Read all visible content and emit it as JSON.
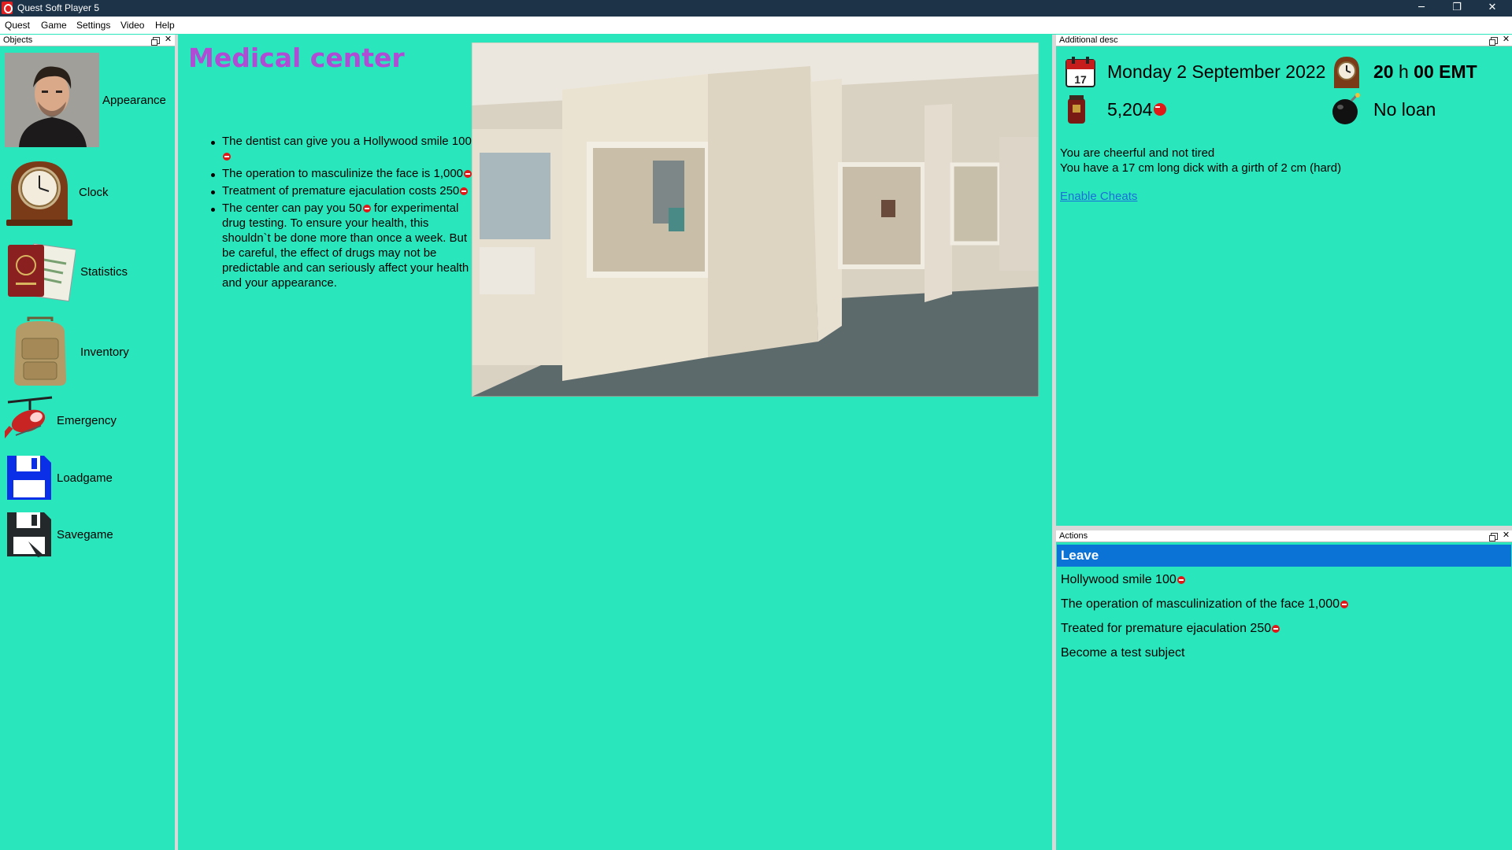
{
  "window": {
    "title": "Quest Soft Player 5",
    "min": "─",
    "restore": "❐",
    "close": "✕"
  },
  "menu": [
    "Quest",
    "Game",
    "Settings",
    "Video",
    "Help"
  ],
  "objects_panel": {
    "title": "Objects",
    "items": [
      {
        "label": "Appearance",
        "icon": "portrait-icon"
      },
      {
        "label": "Clock",
        "icon": "clock-icon"
      },
      {
        "label": "Statistics",
        "icon": "passport-icon"
      },
      {
        "label": "Inventory",
        "icon": "backpack-icon"
      },
      {
        "label": "Emergency",
        "icon": "helicopter-icon"
      },
      {
        "label": "Loadgame",
        "icon": "floppy-blue-icon"
      },
      {
        "label": "Savegame",
        "icon": "floppy-dark-icon"
      }
    ]
  },
  "main": {
    "title": "Medical center",
    "bullets": [
      {
        "text": "The dentist can give you a Hollywood smile 100"
      },
      {
        "text": "The operation to masculinize the face is 1,000"
      },
      {
        "text": "Treatment of premature ejaculation costs 250"
      },
      {
        "pre": "The center can pay you 50",
        "post": " for experimental drug testing. To ensure your health, this shouldn`t be done more than once a week. But be careful, the effect of drugs may not be predictable and can seriously affect your health and your appearance."
      }
    ]
  },
  "desc_panel": {
    "title": "Additional desc",
    "date": "Monday 2 September 2022",
    "calendar_day": "17",
    "time_hours": "20",
    "time_h": "h",
    "time_minutes": "00 EMT",
    "money": "5,204",
    "loan": "No loan",
    "status_lines": [
      "You are cheerful and not tired",
      "You have a 17 cm long dick with a girth of 2 cm  (hard)"
    ],
    "cheat_link": "Enable Cheats"
  },
  "actions_panel": {
    "title": "Actions",
    "items": [
      {
        "label": "Leave",
        "selected": true
      },
      {
        "label": "Hollywood smile 100",
        "coin": true
      },
      {
        "label": "The operation of masculinization of the face 1,000",
        "coin": true
      },
      {
        "label": "Treated for premature ejaculation 250",
        "coin": true
      },
      {
        "label": "Become a test subject",
        "coin": false
      }
    ]
  },
  "colors": {
    "background": "#2ae6bd",
    "title_purple": "#b04bd6",
    "selection_blue": "#0b73d6",
    "titlebar": "#1c3348"
  }
}
